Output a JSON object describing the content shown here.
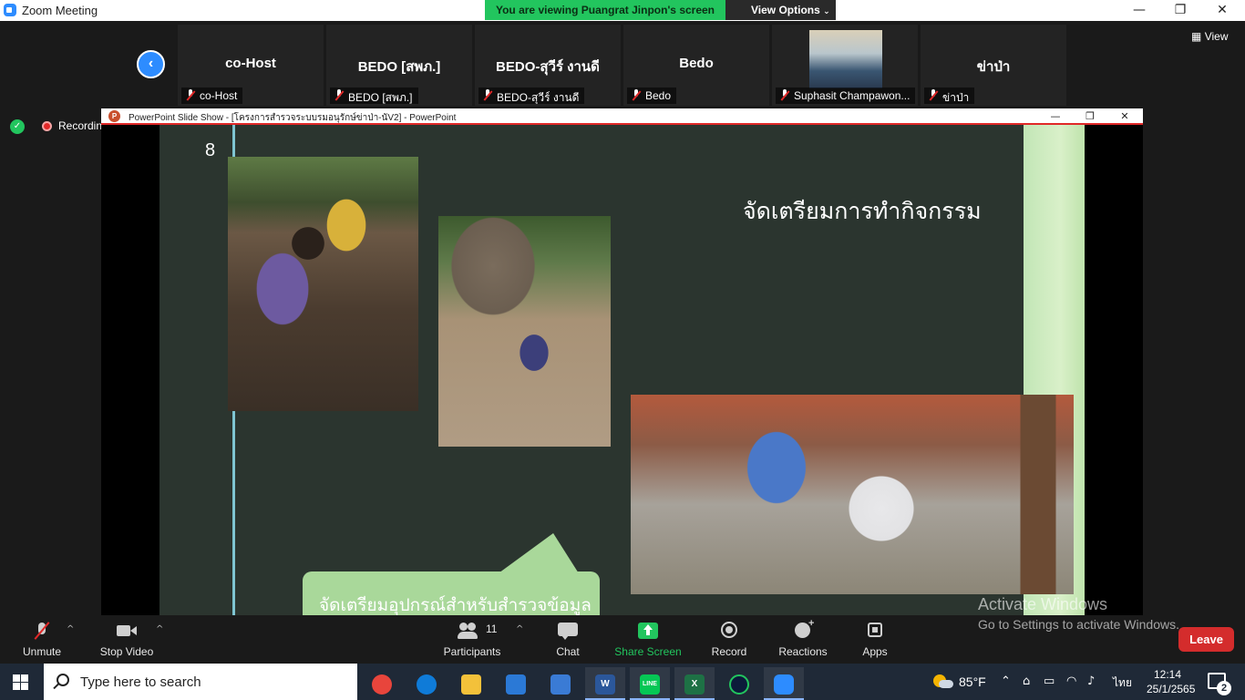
{
  "window": {
    "title": "Zoom Meeting",
    "minimize": "—",
    "restore": "❐",
    "close": "✕"
  },
  "share_banner": {
    "text": "You are viewing Puangrat Jinpon's screen",
    "view_options": "View Options"
  },
  "participants_strip": {
    "view_label": "View",
    "tiles": [
      {
        "name": "co-Host",
        "label": "co-Host"
      },
      {
        "name": "BEDO [สพภ.]",
        "label": "BEDO [สพภ.]"
      },
      {
        "name": "BEDO-สุวีร์ งานดี",
        "label": "BEDO-สุวีร์ งานดี"
      },
      {
        "name": "Bedo",
        "label": "Bedo"
      },
      {
        "name": "",
        "label": "Suphasit Champawon..."
      },
      {
        "name": "ข่าป่า",
        "label": "ข่าป่า"
      }
    ]
  },
  "recording": {
    "label": "Recording"
  },
  "ppt": {
    "title": "PowerPoint Slide Show - [โครงการสำรวจระบบรมอนุรักษ์ข่าป่า-นัV2] - PowerPoint",
    "app_letter": "P",
    "slide": {
      "number": "8",
      "title": "จัดเตรียมการทำกิจกรรม",
      "callout": "จัดเตรียมอุปกรณ์สำหรับสำรวจข้อมูล"
    }
  },
  "watermark": {
    "title": "Activate Windows",
    "subtitle": "Go to Settings to activate Windows."
  },
  "toolbar": {
    "unmute": "Unmute",
    "stop_video": "Stop Video",
    "participants": "Participants",
    "participants_count": "11",
    "chat": "Chat",
    "share_screen": "Share Screen",
    "record": "Record",
    "reactions": "Reactions",
    "apps": "Apps",
    "leave": "Leave"
  },
  "taskbar": {
    "search_placeholder": "Type here to search",
    "weather": "85°F",
    "language": "ไทย",
    "time": "12:14",
    "date": "25/1/2565",
    "notifications": "2",
    "apps": [
      {
        "name": "chrome",
        "color": "#e8453c"
      },
      {
        "name": "edge",
        "color": "#0f7bd8"
      },
      {
        "name": "explorer",
        "color": "#f3c13a"
      },
      {
        "name": "mail",
        "color": "#2b79d6"
      },
      {
        "name": "store",
        "color": "#3a7bd5"
      },
      {
        "name": "word",
        "color": "#2b579a"
      },
      {
        "name": "line",
        "color": "#06c755"
      },
      {
        "name": "excel",
        "color": "#1e7145"
      },
      {
        "name": "webex",
        "color": "#0c1b3a"
      },
      {
        "name": "zoom",
        "color": "#2d8cff"
      }
    ]
  },
  "colors": {
    "share_green": "#22c55e",
    "zoom_blue": "#2d8cff",
    "leave_red": "#d42c2c",
    "slide_bg": "#2b352f",
    "callout_green": "#a9d89a"
  }
}
